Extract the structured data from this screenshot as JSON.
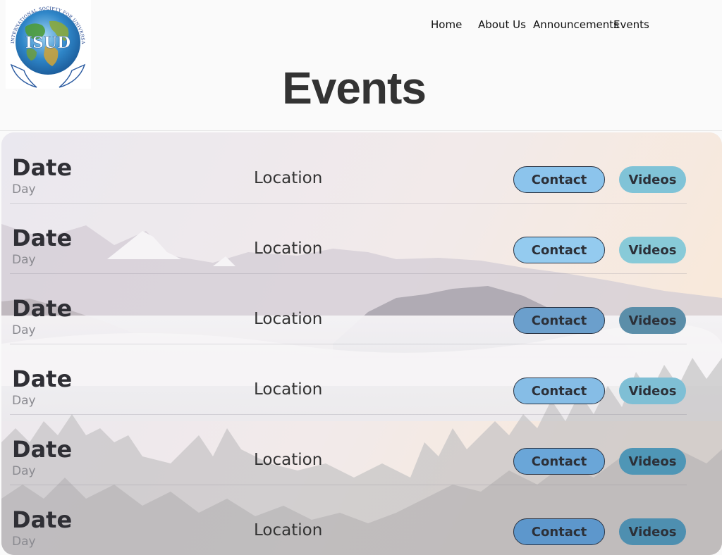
{
  "logo": {
    "text": "ISUD",
    "ring_text": "INTERNATIONAL SOCIETY FOR UNIVERSAL DIALOGUE"
  },
  "nav": [
    {
      "label": "Home"
    },
    {
      "label": "About Us"
    },
    {
      "label": "Announcements"
    },
    {
      "label": "Events"
    }
  ],
  "page": {
    "title": "Events"
  },
  "events": [
    {
      "date": "Date",
      "day": "Day",
      "location": "Location",
      "contact_label": "Contact",
      "videos_label": "Videos"
    },
    {
      "date": "Date",
      "day": "Day",
      "location": "Location",
      "contact_label": "Contact",
      "videos_label": "Videos"
    },
    {
      "date": "Date",
      "day": "Day",
      "location": "Location",
      "contact_label": "Contact",
      "videos_label": "Videos"
    },
    {
      "date": "Date",
      "day": "Day",
      "location": "Location",
      "contact_label": "Contact",
      "videos_label": "Videos"
    },
    {
      "date": "Date",
      "day": "Day",
      "location": "Location",
      "contact_label": "Contact",
      "videos_label": "Videos"
    },
    {
      "date": "Date",
      "day": "Day",
      "location": "Location",
      "contact_label": "Contact",
      "videos_label": "Videos"
    }
  ],
  "colors": {
    "contact_fills": [
      "#8cc4ec",
      "#94cbef",
      "#6b9fcc",
      "#86bde6",
      "#6aa6d8",
      "#5d97cc"
    ],
    "videos_fills": [
      "#80c3d7",
      "#88cad8",
      "#5b8ea9",
      "#7fbfd5",
      "#4f96b6",
      "#4e8fb0"
    ]
  }
}
